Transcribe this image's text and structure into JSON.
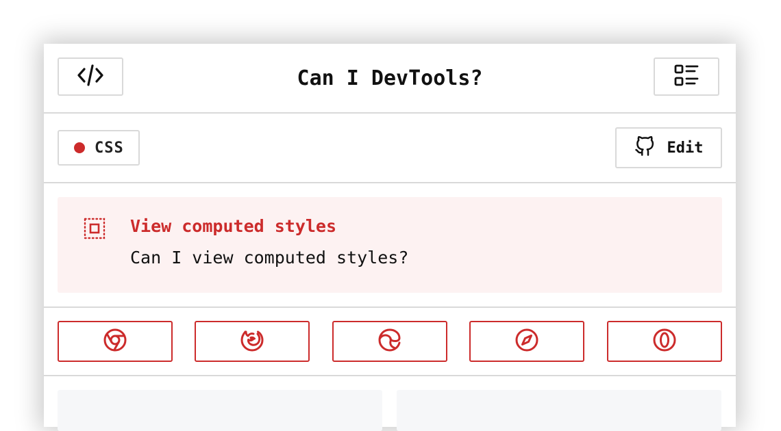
{
  "header": {
    "title": "Can I DevTools?",
    "left_icon": "code-icon",
    "right_icon": "list-icon"
  },
  "meta": {
    "category": "CSS",
    "category_color": "#cc2b2b",
    "edit_label": "Edit",
    "edit_icon": "github-icon"
  },
  "feature": {
    "icon": "select-box-icon",
    "title": "View computed styles",
    "description": "Can I view computed styles?"
  },
  "browsers": [
    {
      "name": "chrome",
      "icon": "chrome-icon"
    },
    {
      "name": "firefox",
      "icon": "firefox-icon"
    },
    {
      "name": "edge",
      "icon": "edge-icon"
    },
    {
      "name": "safari",
      "icon": "safari-icon"
    },
    {
      "name": "opera",
      "icon": "opera-icon"
    }
  ],
  "colors": {
    "accent": "#cc2b2b",
    "feature_bg": "#fdf2f2",
    "border": "#d9d9d9"
  }
}
